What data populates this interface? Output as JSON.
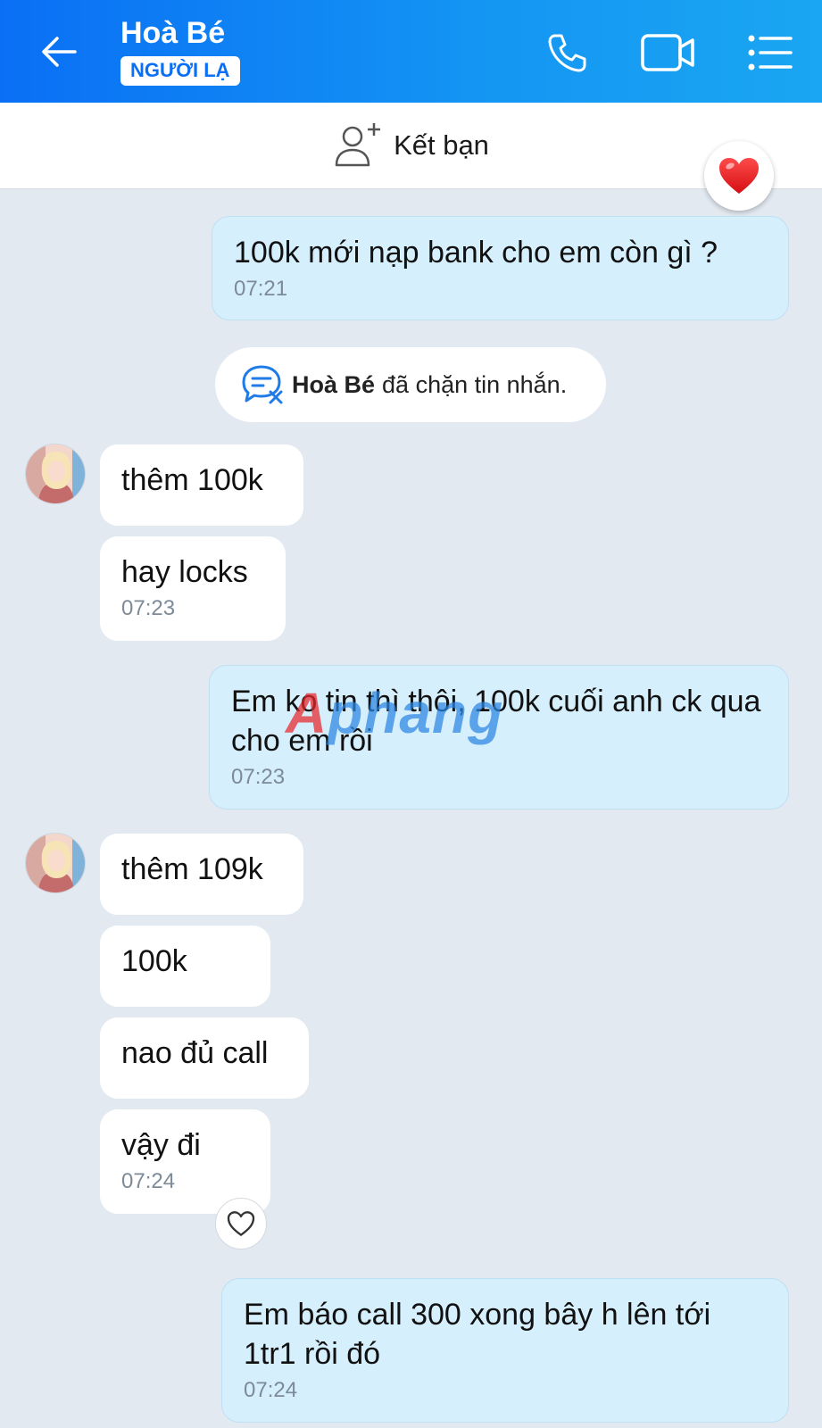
{
  "header": {
    "contact_name": "Hoà Bé",
    "badge": "NGƯỜI LẠ"
  },
  "friend_bar": {
    "label": "Kết bạn"
  },
  "system_notice": {
    "name": "Hoà Bé",
    "text": "đã chặn tin nhắn."
  },
  "messages": [
    {
      "side": "out",
      "text": "100k mới nạp bank cho em còn gì ?",
      "time": "07:21"
    },
    {
      "side": "in",
      "text": "thêm 100k"
    },
    {
      "side": "in",
      "text": "hay locks",
      "time": "07:23"
    },
    {
      "side": "out",
      "text": "Em ko tin thì thôi, 100k cuối anh ck qua cho em rồi",
      "time": "07:23"
    },
    {
      "side": "in",
      "text": "thêm 109k"
    },
    {
      "side": "in",
      "text": "100k"
    },
    {
      "side": "in",
      "text": "nao đủ call"
    },
    {
      "side": "in",
      "text": "vậy đi",
      "time": "07:24"
    },
    {
      "side": "out",
      "text": "Em báo call 300 xong bây h lên tới 1tr1 rồi đó",
      "time": "07:24"
    }
  ],
  "watermark": {
    "part1": "A",
    "part2": "phang"
  },
  "icons": {
    "back": "arrow-left-icon",
    "call": "phone-icon",
    "video": "video-camera-icon",
    "menu": "list-menu-icon",
    "add_friend": "user-plus-icon",
    "blocked": "chat-blocked-icon",
    "reaction": "heart-icon"
  },
  "colors": {
    "header_start": "#0a6ff5",
    "header_end": "#1aa6f2",
    "outgoing_bubble": "#d5effd",
    "incoming_bubble": "#ffffff",
    "chat_background": "#e2e9f1",
    "heart_red": "#e8262a"
  }
}
